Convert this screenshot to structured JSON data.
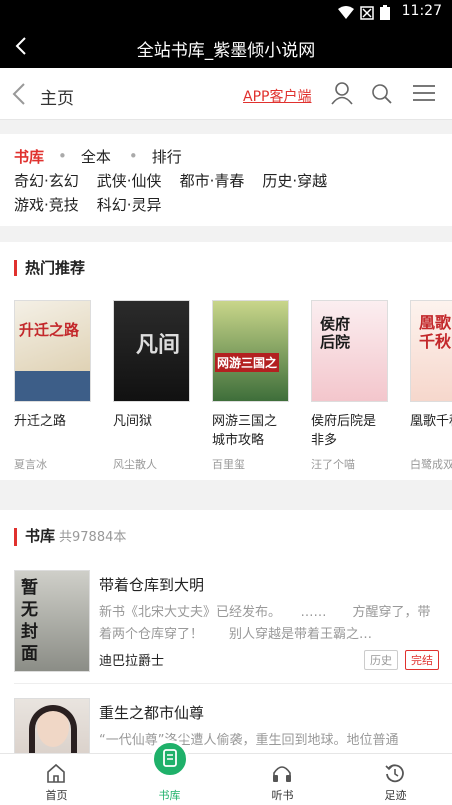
{
  "status": {
    "time": "11:27"
  },
  "titlebar": {
    "title": "全站书库_紫墨倾小说网"
  },
  "nav": {
    "home": "主页",
    "app": "APP客户端"
  },
  "categories": {
    "active": "书库",
    "row1": [
      "全本",
      "排行"
    ],
    "row2": [
      "奇幻·玄幻",
      "武侠·仙侠",
      "都市·青春",
      "历史·穿越"
    ],
    "row3": [
      "游戏·竞技",
      "科幻·灵异"
    ]
  },
  "hot": {
    "title": "热门推荐",
    "books": [
      {
        "name": "升迁之路",
        "author": "夏言冰",
        "cover": "升迁之路"
      },
      {
        "name": "凡间狱",
        "author": "风尘散人",
        "cover": "凡间"
      },
      {
        "name": "网游三国之城市攻略",
        "author": "百里玺",
        "cover": "网游三国之"
      },
      {
        "name": "侯府后院是非多",
        "author": "汪了个喵",
        "cover": "侯府后院"
      },
      {
        "name": "凰歌千秋",
        "author": "白鹭成双",
        "cover": "凰歌千秋"
      }
    ]
  },
  "library": {
    "title": "书库",
    "count": "共97884本",
    "books": [
      {
        "name": "带着仓库到大明",
        "desc": "新书《北宋大丈夫》已经发布。　　……　　方醒穿了，带着两个仓库穿了！　　别人穿越是带着王霸之…",
        "author": "迪巴拉爵士",
        "tag1": "历史",
        "tag2": "完结",
        "cover": "暂无封面"
      },
      {
        "name": "重生之都市仙尊",
        "desc": "“一代仙尊”洛尘遭人偷袭，重生回到地球。地位普通",
        "author": "",
        "tag1": "",
        "tag2": "",
        "cover": ""
      }
    ]
  },
  "tabs": [
    {
      "label": "首页",
      "icon": "home-icon"
    },
    {
      "label": "书库",
      "icon": "book-icon"
    },
    {
      "label": "听书",
      "icon": "headphones-icon"
    },
    {
      "label": "足迹",
      "icon": "history-icon"
    }
  ],
  "colors": {
    "accent": "#e0312e",
    "tab_active": "#1fb16a"
  }
}
